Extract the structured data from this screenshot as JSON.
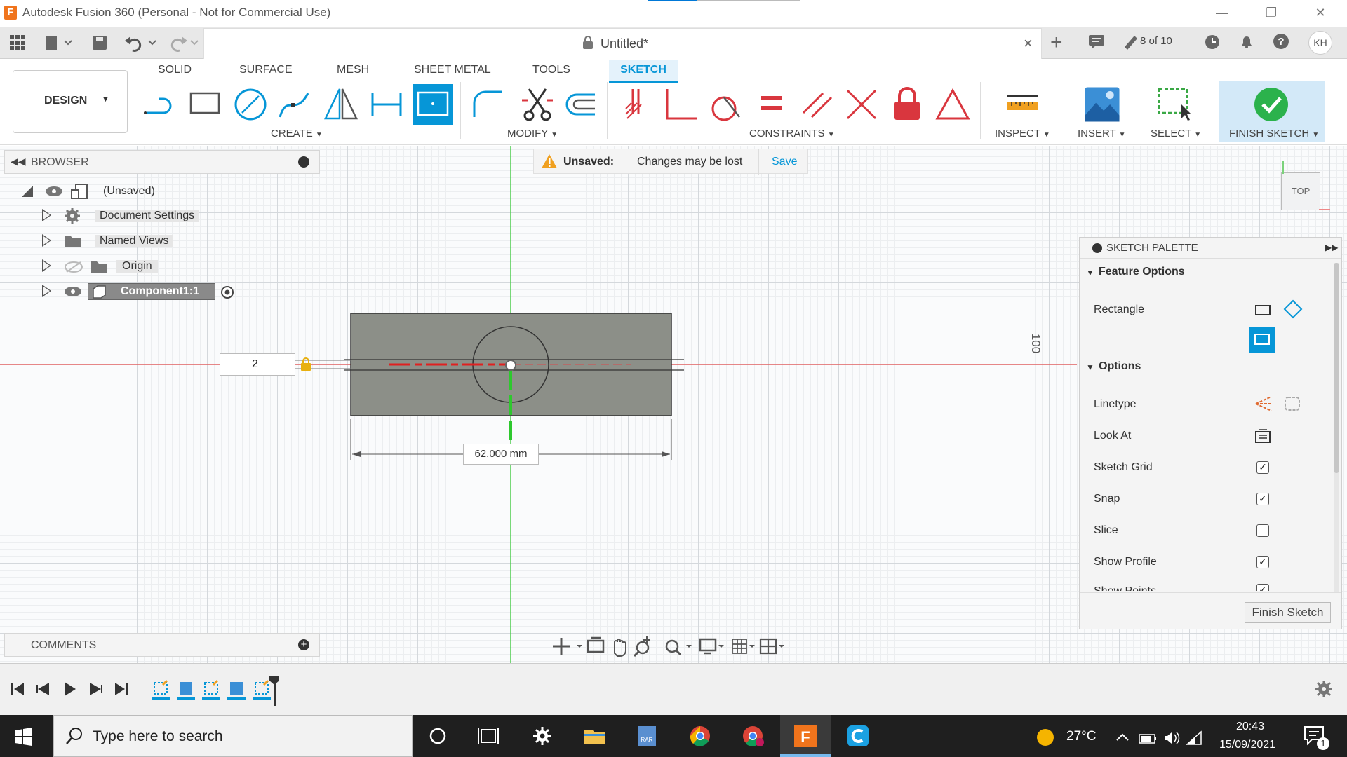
{
  "window": {
    "title": "Autodesk Fusion 360 (Personal - Not for Commercial Use)",
    "logo": "F"
  },
  "appbar": {
    "doc_title": "Untitled*",
    "version": "8 of 10",
    "user": "KH"
  },
  "ribbon": {
    "workspace": "DESIGN",
    "tabs": [
      "SOLID",
      "SURFACE",
      "MESH",
      "SHEET METAL",
      "TOOLS",
      "SKETCH"
    ],
    "groups": {
      "create": "CREATE",
      "modify": "MODIFY",
      "constraints": "CONSTRAINTS",
      "inspect": "INSPECT",
      "insert": "INSERT",
      "select": "SELECT",
      "finish": "FINISH SKETCH"
    }
  },
  "browser": {
    "title": "BROWSER",
    "root": "(Unsaved)",
    "items": [
      "Document Settings",
      "Named Views",
      "Origin",
      "Component1:1"
    ]
  },
  "notice": {
    "label": "Unsaved:",
    "message": "Changes may be lost",
    "action": "Save"
  },
  "sketch": {
    "dimension": "62.000 mm",
    "input_value": "2",
    "ruler": "100"
  },
  "viewcube": {
    "face": "TOP"
  },
  "palette": {
    "title": "SKETCH PALETTE",
    "feature_options": "Feature Options",
    "rectangle": "Rectangle",
    "options": "Options",
    "rows": [
      {
        "label": "Linetype"
      },
      {
        "label": "Look At"
      },
      {
        "label": "Sketch Grid",
        "checked": true
      },
      {
        "label": "Snap",
        "checked": true
      },
      {
        "label": "Slice",
        "checked": false
      },
      {
        "label": "Show Profile",
        "checked": true
      },
      {
        "label": "Show Points",
        "checked": true
      }
    ],
    "finish_button": "Finish Sketch"
  },
  "comments": {
    "title": "COMMENTS"
  },
  "taskbar": {
    "search_placeholder": "Type here to search",
    "temperature": "27°C",
    "time": "20:43",
    "date": "15/09/2021",
    "notifications": "1"
  },
  "colors": {
    "accent": "#0696d7",
    "constraint_red": "#d9363e",
    "finish_green": "#2bb24c",
    "sketch_fill": "#8c8f88"
  }
}
